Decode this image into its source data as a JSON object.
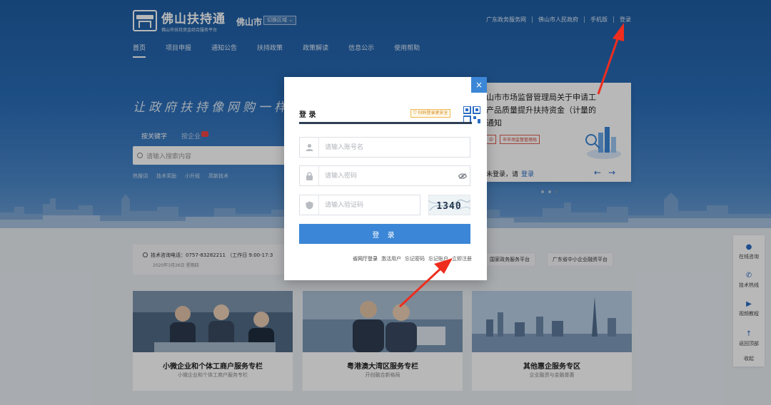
{
  "header": {
    "logo_title": "佛山扶持通",
    "logo_sub": "佛山市扶持资金综合服务平台",
    "city": "佛山市",
    "city_switch": "切换区域",
    "toplinks": [
      "广东政务服务网",
      "佛山市人民政府",
      "手机版",
      "登录"
    ]
  },
  "nav": {
    "items": [
      "首页",
      "项目申报",
      "通知公告",
      "扶持政策",
      "政策解读",
      "信息公示",
      "使用帮助"
    ],
    "active_index": 0
  },
  "hero": {
    "slogan": "让政府扶持像网购一样",
    "search_tabs": [
      "按关键字",
      "按企业"
    ],
    "search_placeholder": "请输入搜索内容",
    "hot_words": [
      "热搜词",
      "技术奖励",
      "小升规",
      "高新技术"
    ]
  },
  "news": {
    "title": "山市市场监督管理局关于申请工产品质量提升扶持资金（计量的通知",
    "tags": [
      "中",
      "市市场监督管理局"
    ],
    "login_prompt": "未登录，请",
    "login_link": "登录"
  },
  "info": {
    "phone": "技术咨询电话：0757-83282211 （工作日 9:00-17:3",
    "date": "2020年3月26日 星期四",
    "platforms": [
      "国家政务服务平台",
      "广东省中小企业融资平台"
    ]
  },
  "cards": [
    {
      "title": "小微企业和个体工商户服务专栏",
      "sub": "小微企业和个体工商户服务专栏"
    },
    {
      "title": "粤港澳大湾区服务专栏",
      "sub": "开创融合新格局"
    },
    {
      "title": "其他惠企服务专区",
      "sub": "企业融资与金融普惠"
    }
  ],
  "sidebar": {
    "items": [
      "在线咨询",
      "技术热线",
      "视频教程",
      "返回顶部",
      "收起"
    ]
  },
  "modal": {
    "close": "×",
    "title": "登 录",
    "qr_hint": "扫码登录更安全",
    "account_placeholder": "请输入账号名",
    "password_placeholder": "请输入密码",
    "captcha_placeholder": "请输入验证码",
    "captcha_text": "1340",
    "login_button": "登 录",
    "links": [
      "省网厅登录",
      "激活用户",
      "忘记密码",
      "忘记账户",
      "立即注册"
    ]
  },
  "colors": {
    "primary": "#3b86d6",
    "hero": "#2a6db8",
    "annotation": "#ee2d1f"
  }
}
